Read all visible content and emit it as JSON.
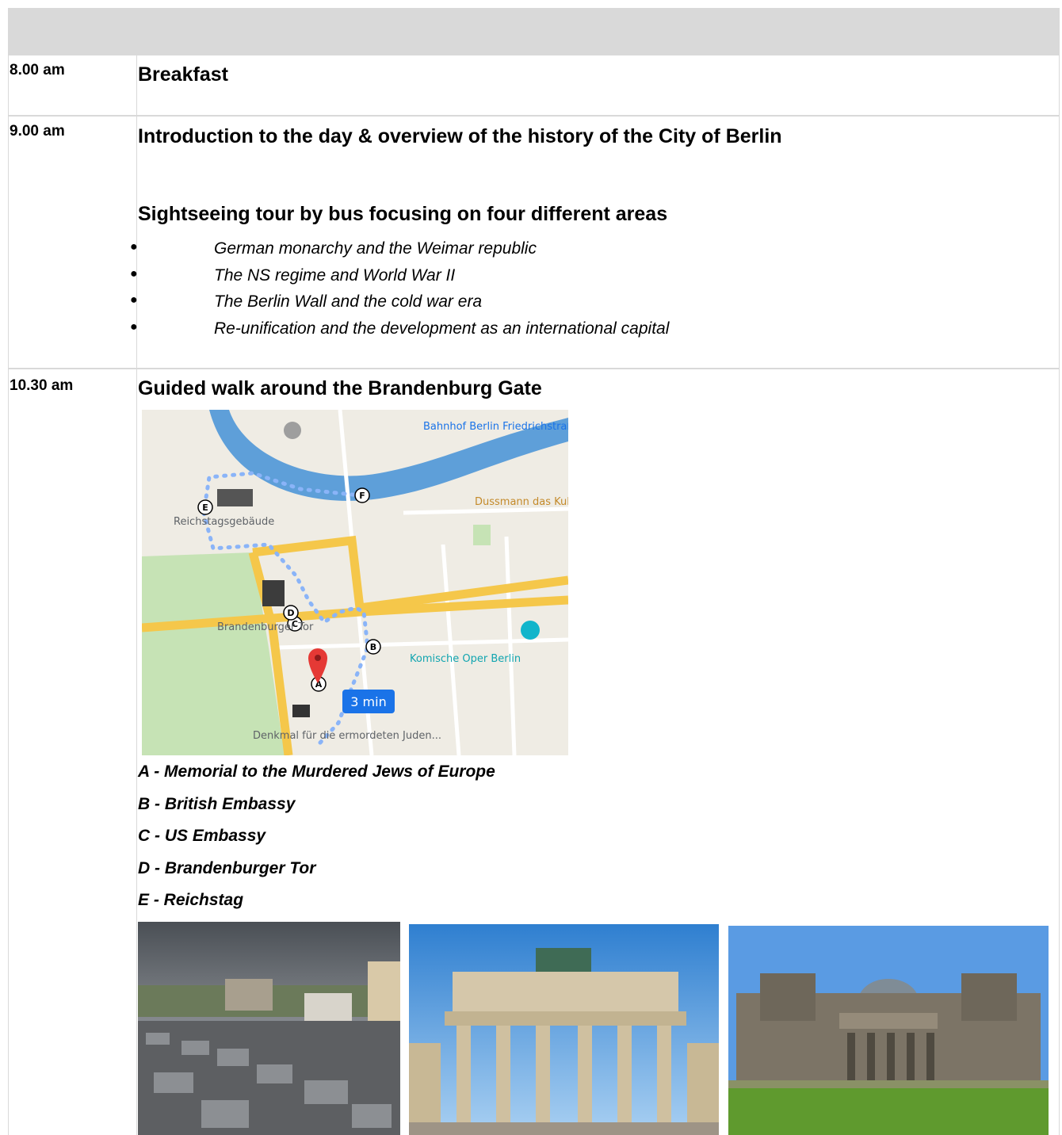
{
  "schedule": [
    {
      "time": "8.00 am",
      "title": "Breakfast"
    },
    {
      "time": "9.00 am",
      "title": "Introduction to the day &  overview of the history of the City of Berlin",
      "subtitle": "Sightseeing tour by bus focusing on four different areas",
      "topics": [
        "German monarchy and the Weimar republic",
        "The NS regime and World War II",
        "The Berlin Wall and the cold war era",
        "Re-unification and the development as an international capital"
      ],
      "bullet_glyph": "●"
    },
    {
      "time": "10.30 am",
      "title": "Guided walk around the Brandenburg Gate",
      "legend": [
        "A - Memorial to the Murdered Jews of Europe",
        "B - British Embassy",
        "C - US Embassy",
        "D - Brandenburger Tor",
        "E - Reichstag"
      ]
    }
  ],
  "map": {
    "labels": {
      "station": "Bahnhof Berlin Friedrichstraße",
      "dussmann": "Dussmann das KulturKaufhaus",
      "reichstag": "Reichstagsgebäude",
      "gate": "Brandenburger Tor",
      "opera": "Komische Oper Berlin",
      "memorial": "Denkmal für die ermordeten Juden...",
      "route_time": "3 min",
      "route_stops": [
        "A",
        "B",
        "C",
        "D",
        "E",
        "F"
      ]
    },
    "colors": {
      "river": "#5e9fd9",
      "park": "#c6e3b5",
      "road": "#f5c74a",
      "route": "#8ab4f8",
      "pin": "#e53935",
      "time_badge": "#1a73e8"
    }
  },
  "photos": [
    {
      "name": "memorial-photo",
      "icon": "memorial-image"
    },
    {
      "name": "brandenburg-gate-photo",
      "icon": "gate-image"
    },
    {
      "name": "reichstag-photo",
      "icon": "reichstag-image"
    }
  ]
}
